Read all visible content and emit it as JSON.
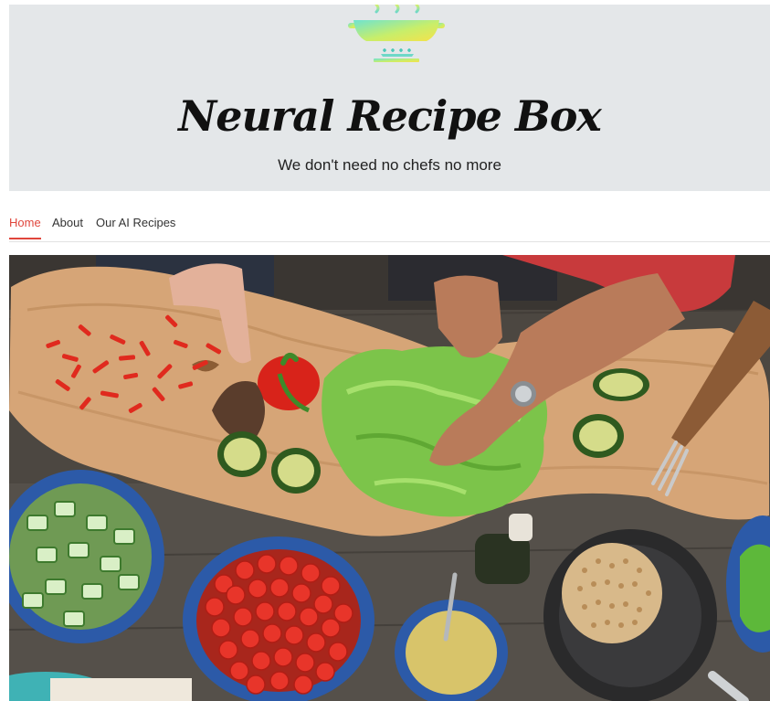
{
  "header": {
    "title": "Neural Recipe Box",
    "tagline": "We don't need no chefs no more",
    "logo_icon": "steaming-pot-icon"
  },
  "nav": {
    "items": [
      {
        "label": "Home",
        "active": true
      },
      {
        "label": "About",
        "active": false
      },
      {
        "label": "Our AI Recipes",
        "active": false
      }
    ]
  },
  "hero": {
    "image_subject": "hands-chopping-vegetables-photo"
  },
  "colors": {
    "header_bg": "#e4e7e9",
    "accent": "#e0463c",
    "nav_text": "#333333"
  }
}
